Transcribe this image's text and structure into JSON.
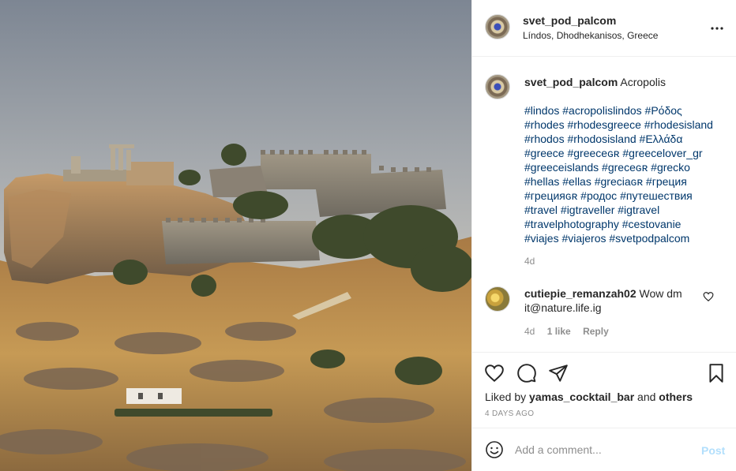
{
  "post": {
    "username": "svet_pod_palcom",
    "location": "Líndos, Dhodhekanisos, Greece",
    "more_icon": "more-horizontal-icon"
  },
  "caption": {
    "username": "svet_pod_palcom",
    "title": "Acropolis",
    "hashtag_lines": [
      "#lindos #acropolislindos #Ρόδος",
      "#rhodes #rhodesgreece #rhodesisland",
      "#rhodos #rhodosisland #Ελλάδα",
      "#greece #greeceɢʀ #greecelover_gr",
      "#greeceislands #greceɢʀ #grecko",
      "#hellas #ellas #greciaɢʀ #греция",
      "#грецияɢʀ #родос #путешествия",
      "#travel #igtraveller #igtravel",
      "#travelphotography #cestovanie",
      "#viajes #viajeros #svetpodpalcom"
    ],
    "time": "4d"
  },
  "comments": [
    {
      "username": "cutiepie_remanzah02",
      "text": "Wow dm it@nature.life.ig",
      "time": "4d",
      "likes": "1 like",
      "reply": "Reply"
    }
  ],
  "actions": {
    "liked_by_prefix": "Liked by",
    "liked_by_user": "yamas_cocktail_bar",
    "liked_by_and": "and",
    "liked_by_others": "others",
    "date": "4 DAYS AGO"
  },
  "add_comment": {
    "placeholder": "Add a comment...",
    "post_label": "Post"
  },
  "colors": {
    "link": "#00376b",
    "muted": "#8e8e8e",
    "post_disabled": "#b2dffc"
  }
}
